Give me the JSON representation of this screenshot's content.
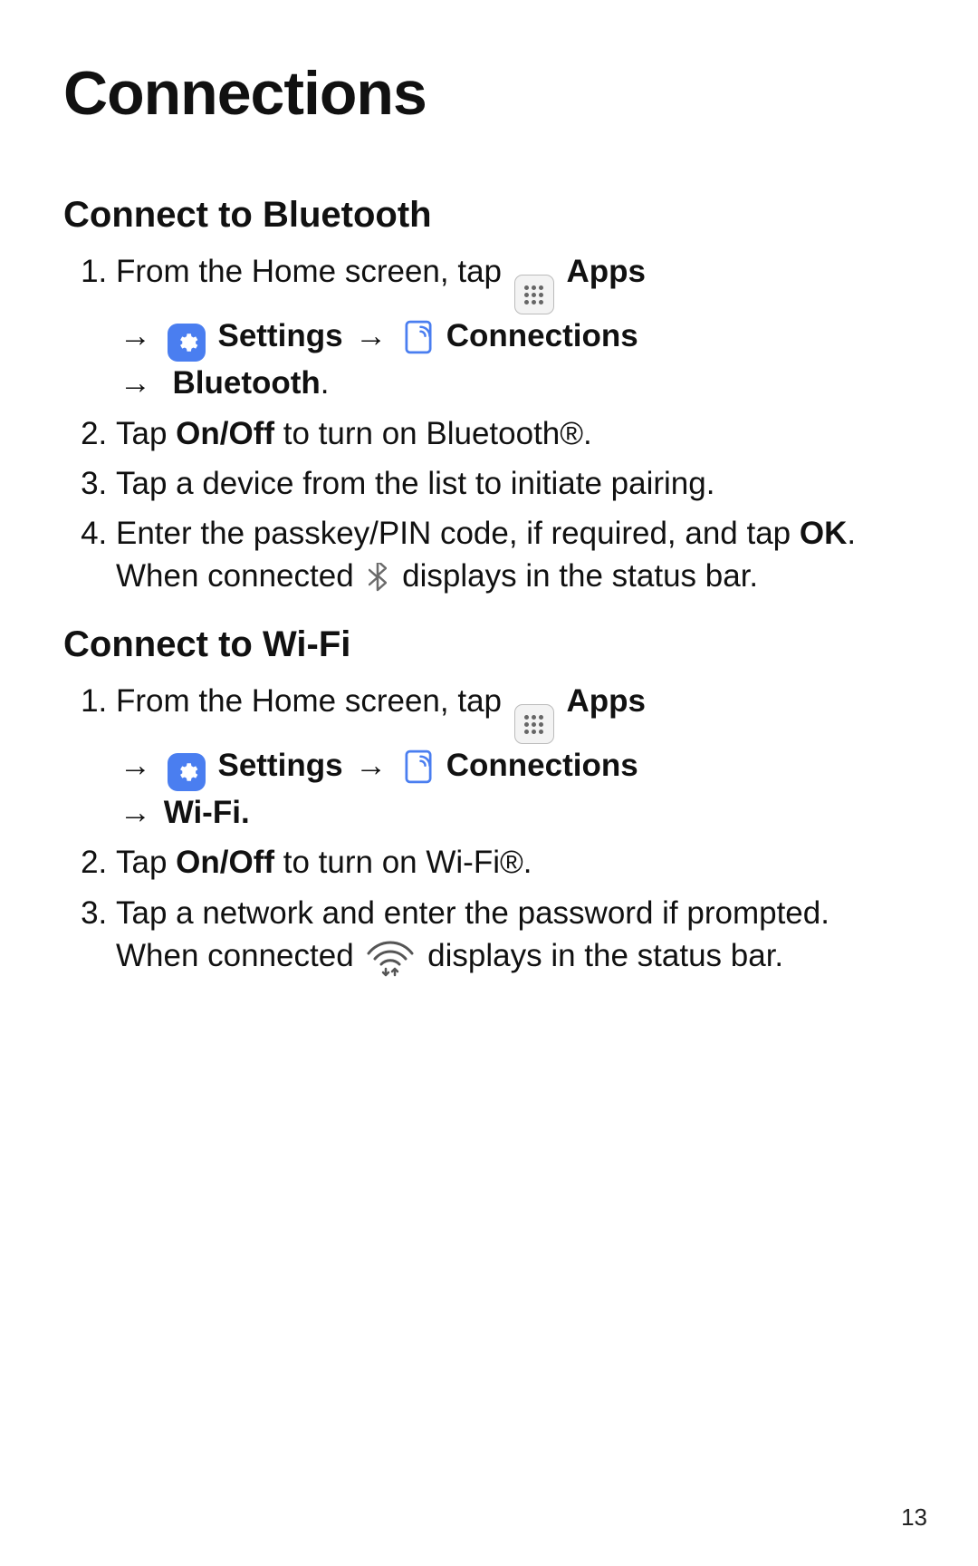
{
  "page": {
    "title": "Connections",
    "number": "13"
  },
  "common": {
    "arrow": "→",
    "from_home_tap": "From the Home screen, tap ",
    "apps": "Apps",
    "settings": "Settings",
    "connections": "Connections"
  },
  "bluetooth": {
    "heading": "Connect to Bluetooth",
    "final_target": "Bluetooth",
    "period": ".",
    "step2_pre": "Tap ",
    "step2_bold": "On/Off",
    "step2_post": " to turn on Bluetooth®.",
    "step3": "Tap a device from the list to initiate pairing.",
    "step4_pre": "Enter the passkey/PIN code, if required, and tap ",
    "step4_ok": "OK",
    "step4_mid": ". When connected ",
    "step4_post": " displays in the status bar."
  },
  "wifi": {
    "heading": "Connect to Wi-Fi",
    "final_target": "Wi-Fi.",
    "step2_pre": "Tap ",
    "step2_bold": "On/Off",
    "step2_post": " to turn on Wi-Fi®.",
    "step3_pre": "Tap a network and enter the password if prompted. When connected ",
    "step3_post": " displays in the status bar."
  }
}
